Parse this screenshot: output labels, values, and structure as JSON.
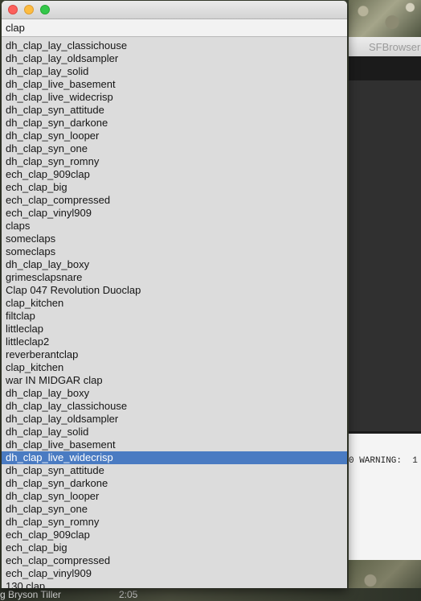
{
  "background": {
    "browser_title": "SFBrowser",
    "console_text": "0 WARNING:  1",
    "now_playing": "g Bryson Tiller",
    "time": "2:05"
  },
  "popup": {
    "search_value": "clap",
    "selected_index": 32,
    "items": [
      "dh_clap_lay_classichouse",
      "dh_clap_lay_oldsampler",
      "dh_clap_lay_solid",
      "dh_clap_live_basement",
      "dh_clap_live_widecrisp",
      "dh_clap_syn_attitude",
      "dh_clap_syn_darkone",
      "dh_clap_syn_looper",
      "dh_clap_syn_one",
      "dh_clap_syn_romny",
      "ech_clap_909clap",
      "ech_clap_big",
      "ech_clap_compressed",
      "ech_clap_vinyl909",
      "claps",
      "someclaps",
      "someclaps",
      "dh_clap_lay_boxy",
      "grimesclapsnare",
      "Clap 047 Revolution Duoclap",
      "clap_kitchen",
      "filtclap",
      "littleclap",
      "littleclap2",
      "reverberantclap",
      "clap_kitchen",
      "war IN MIDGAR  clap",
      "dh_clap_lay_boxy",
      "dh_clap_lay_classichouse",
      "dh_clap_lay_oldsampler",
      "dh_clap_lay_solid",
      "dh_clap_live_basement",
      "dh_clap_live_widecrisp",
      "dh_clap_syn_attitude",
      "dh_clap_syn_darkone",
      "dh_clap_syn_looper",
      "dh_clap_syn_one",
      "dh_clap_syn_romny",
      "ech_clap_909clap",
      "ech_clap_big",
      "ech_clap_compressed",
      "ech_clap_vinyl909",
      "130 clap"
    ]
  }
}
